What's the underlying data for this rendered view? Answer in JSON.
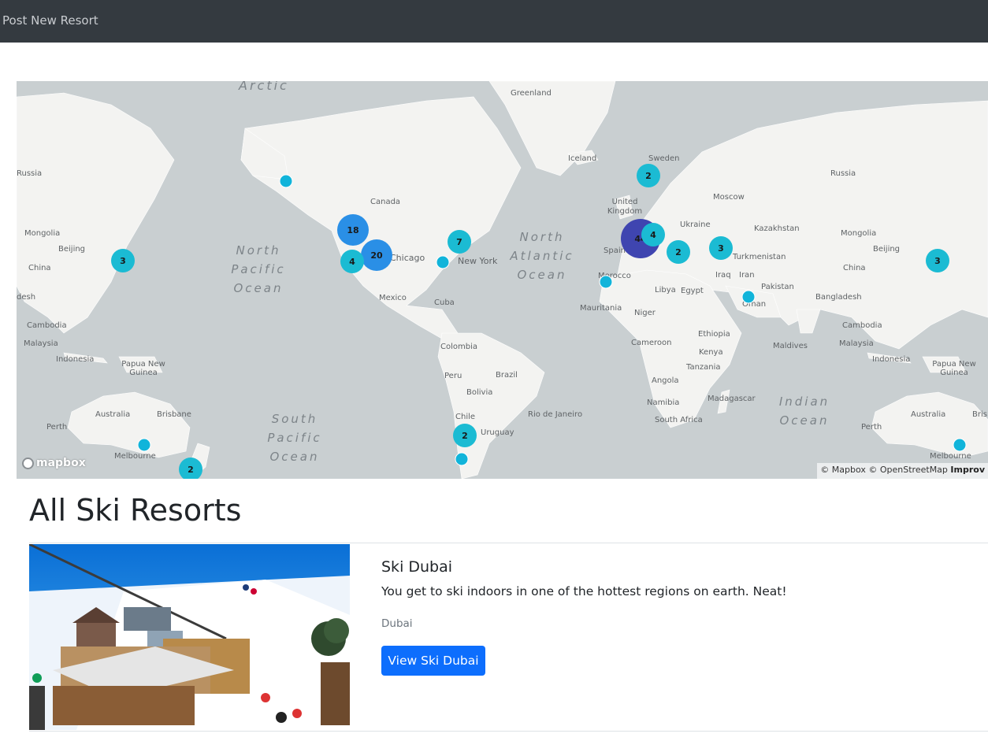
{
  "nav": {
    "link_label": "Post New Resort"
  },
  "map": {
    "labels": {
      "arctic": "Arctic",
      "greenland": "Greenland",
      "iceland": "Iceland",
      "russia_left": "Russia",
      "russia_right": "Russia",
      "mongolia_left": "Mongolia",
      "mongolia_right": "Mongolia",
      "beijing_left": "Beijing",
      "beijing_right": "Beijing",
      "china_left": "China",
      "china_right": "China",
      "desh": "desh",
      "bangladesh": "Bangladesh",
      "cambodia_left": "Cambodia",
      "cambodia_right": "Cambodia",
      "malaysia_left": "Malaysia",
      "malaysia_right": "Malaysia",
      "indonesia_left": "Indonesia",
      "indonesia_right": "Indonesia",
      "png_left": "Papua New Guinea",
      "png_right": "Papua New Guinea",
      "australia_left": "Australia",
      "australia_right": "Australia",
      "brisbane_left": "Brisbane",
      "brisbane_right": "Bris",
      "perth_left": "Perth",
      "perth_right": "Perth",
      "melbourne_left": "Melbourne",
      "melbourne_right": "Melbourne",
      "canada": "Canada",
      "chicago": "Chicago",
      "new_york": "New York",
      "mexico": "Mexico",
      "cuba": "Cuba",
      "colombia": "Colombia",
      "peru": "Peru",
      "brazil": "Brazil",
      "bolivia": "Bolivia",
      "chile": "Chile",
      "uruguay": "Uruguay",
      "rio": "Rio de Janeiro",
      "sweden": "Sweden",
      "uk": "United Kingdom",
      "moscow": "Moscow",
      "ukraine": "Ukraine",
      "kazakhstan": "Kazakhstan",
      "spain": "Spain",
      "morocco": "Morocco",
      "turkmenistan": "Turkmenistan",
      "iraq": "Iraq",
      "iran": "Iran",
      "pakistan": "Pakistan",
      "oman": "Oman",
      "libya": "Libya",
      "egypt": "Egypt",
      "mauritania": "Mauritania",
      "niger": "Niger",
      "ethiopia": "Ethiopia",
      "cameroon": "Cameroon",
      "kenya": "Kenya",
      "tanzania": "Tanzania",
      "angola": "Angola",
      "namibia": "Namibia",
      "madagascar": "Madagascar",
      "south_africa": "South Africa",
      "maldives": "Maldives"
    },
    "oceans": {
      "north_pacific": "North Pacific Ocean",
      "north_atlantic": "North Atlantic Ocean",
      "south_pacific": "South Pacific Ocean",
      "indian": "Indian Ocean"
    },
    "clusters": {
      "japan_left": "3",
      "japan_right": "3",
      "bc": "18",
      "colorado": "20",
      "california": "4",
      "northeast": "7",
      "sweden": "2",
      "alps": "44",
      "central_europe": "4",
      "balkans": "2",
      "caucasus": "3",
      "chile": "2",
      "new_zealand": "2"
    },
    "colors": {
      "small_cluster": "#1bbbd3",
      "medium_cluster": "#2a8fe6",
      "large_cluster": "#3f45b0",
      "single_pin": "#11b4da"
    },
    "logo_text": "mapbox",
    "attribution": "© Mapbox © OpenStreetMap",
    "attribution_link": "Improv"
  },
  "page": {
    "heading": "All Ski Resorts"
  },
  "resorts": [
    {
      "title": "Ski Dubai",
      "description": "You get to ski indoors in one of the hottest regions on earth. Neat!",
      "location": "Dubai",
      "button_label": "View Ski Dubai"
    }
  ]
}
